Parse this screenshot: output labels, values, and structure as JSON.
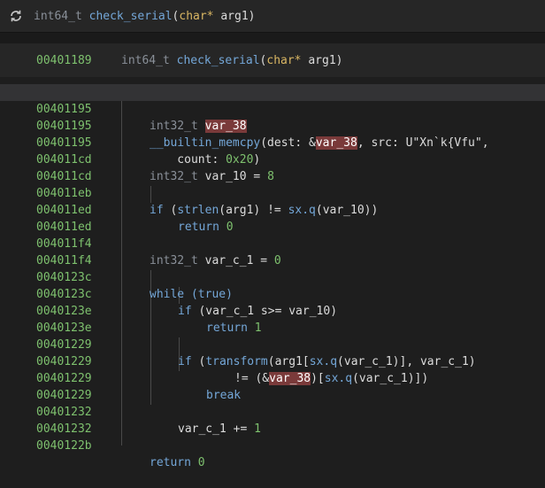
{
  "header": {
    "ret_type": "int64_t",
    "func_name": "check_serial",
    "param_type": "char*",
    "param_name": " arg1"
  },
  "func_bar": {
    "address": "00401189"
  },
  "lines": [
    {
      "addr": "00401195"
    },
    {
      "addr": "00401195"
    },
    {
      "addr": "00401195"
    },
    {
      "addr": "004011cd"
    },
    {
      "addr": "004011cd"
    },
    {
      "addr": "004011eb"
    },
    {
      "addr": "004011ed"
    },
    {
      "addr": "004011ed"
    },
    {
      "addr": "004011f4"
    },
    {
      "addr": "004011f4"
    },
    {
      "addr": "0040123c"
    },
    {
      "addr": "0040123c"
    },
    {
      "addr": "0040123e"
    },
    {
      "addr": "0040123e"
    },
    {
      "addr": "00401229"
    },
    {
      "addr": "00401229"
    },
    {
      "addr": "00401229"
    },
    {
      "addr": "00401229"
    },
    {
      "addr": "00401232"
    },
    {
      "addr": "00401232"
    },
    {
      "addr": "0040122b"
    }
  ],
  "tok": {
    "int32_t": "int32_t",
    "var_38": "var_38",
    "memcpy": "__builtin_memcpy",
    "dest": "(dest: &",
    "src": ", src: U\"Xn`k{Vfu\",",
    "count_indent": "    count: ",
    "count_val": "0x20",
    "count_close": ")",
    "var_10_decl": " var_10 = ",
    "eight": "8",
    "if": "if",
    "strlen": "strlen",
    "strlen_args": "(arg1) != ",
    "sxq": "sx.q",
    "var_10_paren": "(var_10))",
    "return": "return",
    "zero": "0",
    "one": "1",
    "var_c_1_decl": " var_c_1 = ",
    "while": "while",
    "true": "(true)",
    "cond_cmp": " (var_c_1 s>= var_10)",
    "transform": "transform",
    "arg_open": "(arg1[",
    "var_c_1_paren": "(var_c_1)",
    "close_br": "], var_c_1)",
    "ne_amp": "!= (&",
    "close_paren": ")[",
    "end": "])",
    "break": "break",
    "inc": "var_c_1 += ",
    "sp_open": " (",
    "space": " "
  }
}
